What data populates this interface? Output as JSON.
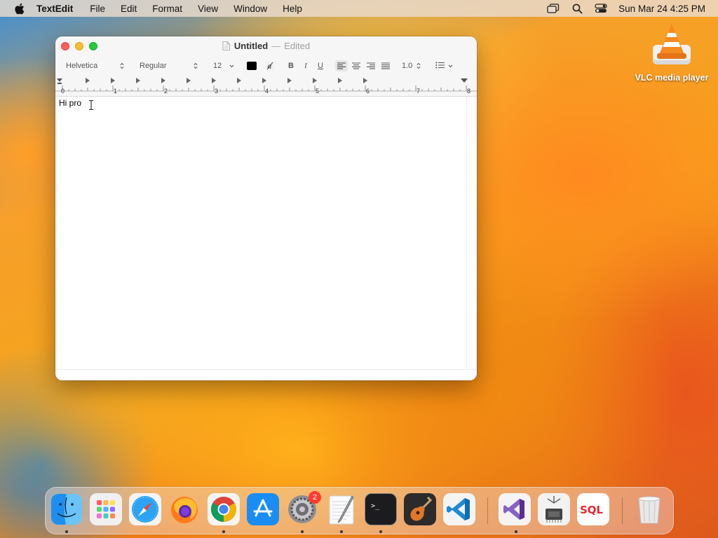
{
  "menubar": {
    "app_name": "TextEdit",
    "items": [
      "File",
      "Edit",
      "Format",
      "View",
      "Window",
      "Help"
    ],
    "clock": "Sun Mar 24  4:25 PM"
  },
  "desktop": {
    "icons": [
      {
        "label": "VLC media player",
        "icon": "vlc-cone-icon"
      }
    ]
  },
  "window": {
    "title": "Untitled",
    "separator": "—",
    "status": "Edited",
    "toolbar": {
      "font_family": "Helvetica",
      "font_style": "Regular",
      "font_size": "12",
      "text_color": "#000000",
      "bold": "B",
      "italic": "I",
      "underline": "U",
      "line_spacing": "1.0"
    },
    "ruler": {
      "labels": [
        "0",
        "1",
        "2",
        "3",
        "4",
        "5",
        "6",
        "7",
        "8"
      ]
    },
    "document_text": "Hi pro"
  },
  "dock": {
    "apps": [
      {
        "name": "Finder",
        "icon": "finder-icon",
        "running": true
      },
      {
        "name": "Launchpad",
        "icon": "launchpad-icon",
        "running": false
      },
      {
        "name": "Safari",
        "icon": "safari-icon",
        "running": false
      },
      {
        "name": "Firefox",
        "icon": "firefox-icon",
        "running": false
      },
      {
        "name": "Chrome",
        "icon": "chrome-icon",
        "running": true
      },
      {
        "name": "App Store",
        "icon": "app-store-icon",
        "running": false
      },
      {
        "name": "System Settings",
        "icon": "settings-gear-icon",
        "running": true,
        "badge": "2"
      },
      {
        "name": "TextEdit",
        "icon": "textedit-icon",
        "running": true
      },
      {
        "name": "Terminal",
        "icon": "terminal-icon",
        "running": true
      },
      {
        "name": "GarageBand",
        "icon": "guitar-icon",
        "running": false
      },
      {
        "name": "Visual Studio Code",
        "icon": "vscode-icon",
        "running": false
      },
      {
        "name": "Visual Studio",
        "icon": "visual-studio-icon",
        "running": true
      },
      {
        "name": "System Information",
        "icon": "chip-icon",
        "running": false
      },
      {
        "name": "SQL",
        "icon": "sql-icon",
        "running": false
      },
      {
        "name": "Trash",
        "icon": "trash-icon",
        "running": false
      }
    ]
  }
}
